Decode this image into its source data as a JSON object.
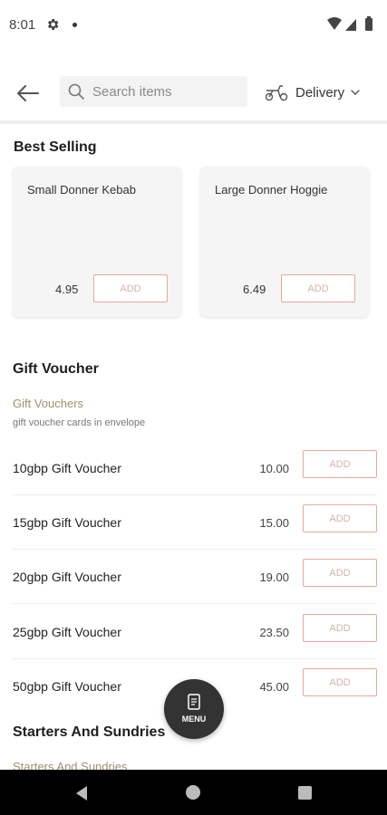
{
  "status_bar": {
    "time": "8:01"
  },
  "header": {
    "search_placeholder": "Search items",
    "delivery_label": "Delivery"
  },
  "best_selling": {
    "title": "Best Selling",
    "items": [
      {
        "name": "Small Donner Kebab",
        "price": "4.95",
        "add_label": "ADD"
      },
      {
        "name": "Large Donner Hoggie",
        "price": "6.49",
        "add_label": "ADD"
      }
    ]
  },
  "gift_voucher": {
    "title": "Gift Voucher",
    "category": "Gift Vouchers",
    "description": "gift voucher cards in envelope",
    "items": [
      {
        "name": "10gbp Gift Voucher",
        "price": "10.00",
        "add_label": "ADD"
      },
      {
        "name": "15gbp Gift Voucher",
        "price": "15.00",
        "add_label": "ADD"
      },
      {
        "name": "20gbp Gift Voucher",
        "price": "19.00",
        "add_label": "ADD"
      },
      {
        "name": "25gbp Gift Voucher",
        "price": "23.50",
        "add_label": "ADD"
      },
      {
        "name": "50gbp Gift Voucher",
        "price": "45.00",
        "add_label": "ADD"
      }
    ]
  },
  "starters": {
    "title": "Starters And Sundries",
    "category": "Starters And Sundries"
  },
  "menu_fab": {
    "label": "MENU"
  },
  "colors": {
    "accent_border": "#e4a99a",
    "category_text": "#a09070",
    "fab_background": "#333333"
  }
}
